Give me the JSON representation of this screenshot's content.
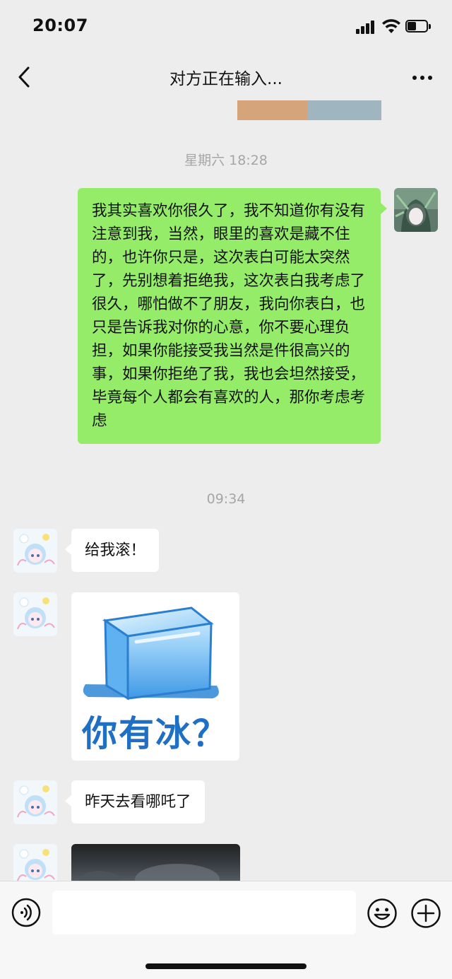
{
  "status_bar": {
    "time": "20:07",
    "battery_level": 0.45
  },
  "header": {
    "title": "对方正在输入..."
  },
  "messages": [
    {
      "type": "timestamp",
      "text": "星期六 18:28"
    },
    {
      "type": "text",
      "sender": "me",
      "text": "我其实喜欢你很久了，我不知道你有没有注意到我，当然，眼里的喜欢是藏不住的，也许你只是，这次表白可能太突然了，先别想着拒绝我，这次表白我考虑了很久，哪怕做不了朋友，我向你表白，也只是告诉我对你的心意，你不要心理负担，如果你能接受我当然是件很高兴的事，如果你拒绝了我，我也会坦然接受，毕竟每个人都会有喜欢的人，那你考虑考虑"
    },
    {
      "type": "timestamp",
      "text": "09:34"
    },
    {
      "type": "text",
      "sender": "them",
      "text": "给我滚！"
    },
    {
      "type": "sticker",
      "sender": "them",
      "text": "你有冰？"
    },
    {
      "type": "text",
      "sender": "them",
      "text": "昨天去看哪吒了"
    },
    {
      "type": "video",
      "sender": "them"
    }
  ],
  "input": {
    "placeholder": ""
  },
  "colors": {
    "background": "#ededed",
    "my_bubble": "#95ec69",
    "their_bubble": "#ffffff",
    "timestamp": "#a6a6a6"
  },
  "icons": [
    "back-arrow-icon",
    "more-icon",
    "voice-icon",
    "emoji-icon",
    "plus-icon",
    "signal-icon",
    "wifi-icon",
    "battery-icon"
  ]
}
